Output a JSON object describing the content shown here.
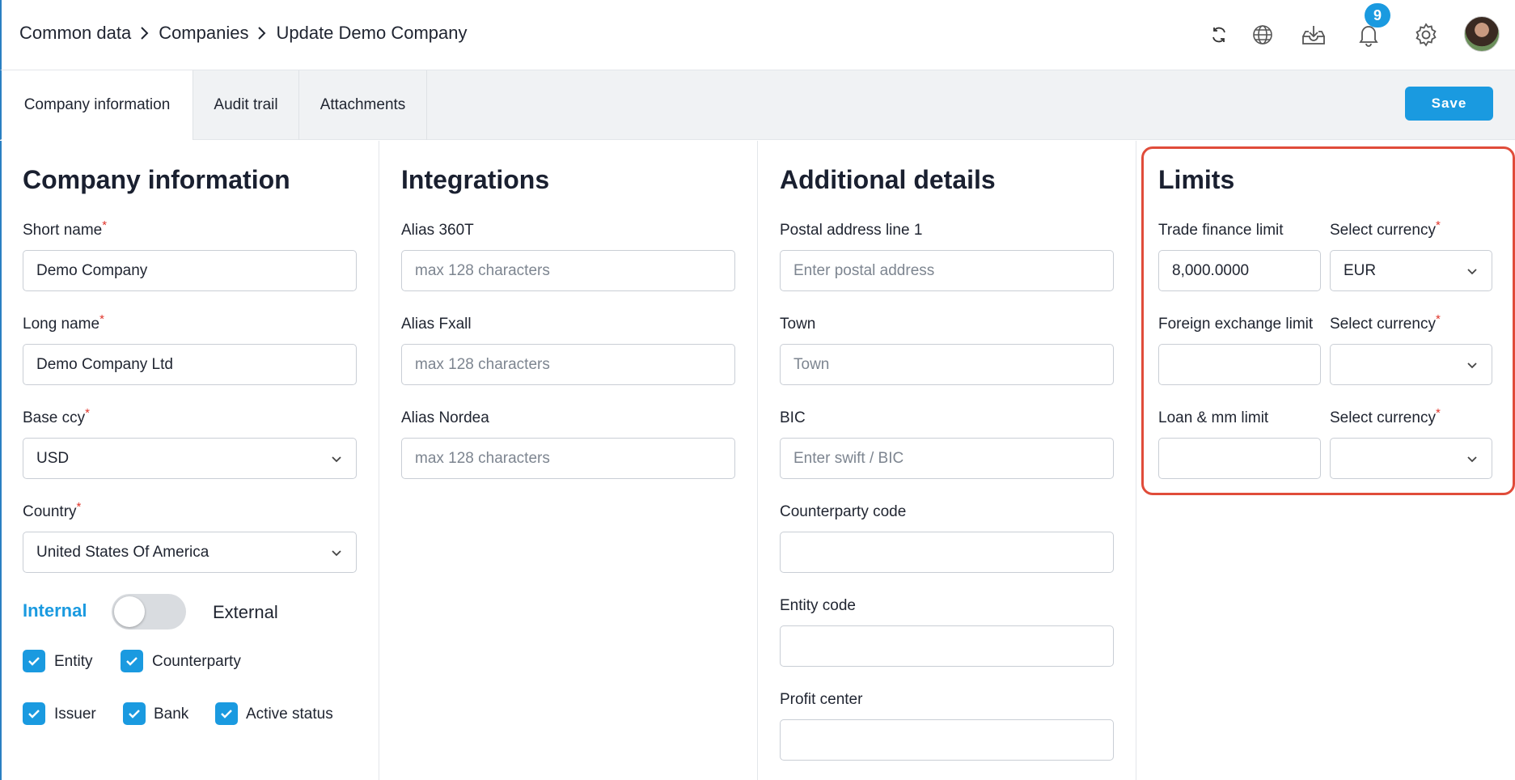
{
  "breadcrumb": [
    "Common data",
    "Companies",
    "Update Demo Company"
  ],
  "notifications": {
    "count": "9"
  },
  "tabs": [
    {
      "label": "Company information",
      "active": true
    },
    {
      "label": "Audit trail",
      "active": false
    },
    {
      "label": "Attachments",
      "active": false
    }
  ],
  "save_label": "Save",
  "company": {
    "title": "Company information",
    "short_name_label": "Short name",
    "short_name_value": "Demo Company",
    "long_name_label": "Long name",
    "long_name_value": "Demo Company Ltd",
    "base_ccy_label": "Base ccy",
    "base_ccy_value": "USD",
    "country_label": "Country",
    "country_value": "United States Of America",
    "internal_label": "Internal",
    "external_label": "External",
    "toggle_external": false,
    "checkboxes": [
      {
        "label": "Entity",
        "checked": true
      },
      {
        "label": "Counterparty",
        "checked": true
      },
      {
        "label": "Issuer",
        "checked": true
      },
      {
        "label": "Bank",
        "checked": true
      },
      {
        "label": "Active status",
        "checked": true
      }
    ]
  },
  "integrations": {
    "title": "Integrations",
    "alias_360t_label": "Alias 360T",
    "alias_fxall_label": "Alias Fxall",
    "alias_nordea_label": "Alias Nordea",
    "placeholder": "max 128 characters"
  },
  "additional": {
    "title": "Additional details",
    "postal_label": "Postal address line 1",
    "postal_placeholder": "Enter postal address",
    "town_label": "Town",
    "town_placeholder": "Town",
    "bic_label": "BIC",
    "bic_placeholder": "Enter swift / BIC",
    "counterparty_code_label": "Counterparty code",
    "entity_code_label": "Entity code",
    "profit_center_label": "Profit center"
  },
  "limits": {
    "title": "Limits",
    "trade_finance_label": "Trade finance limit",
    "trade_finance_value": "8,000.0000",
    "fx_label": "Foreign exchange limit",
    "loan_label": "Loan & mm limit",
    "currency_label": "Select currency",
    "trade_currency_value": "EUR"
  },
  "colors": {
    "accent": "#1a9ae0",
    "required": "#e0352b",
    "highlight": "#e04c3a"
  }
}
